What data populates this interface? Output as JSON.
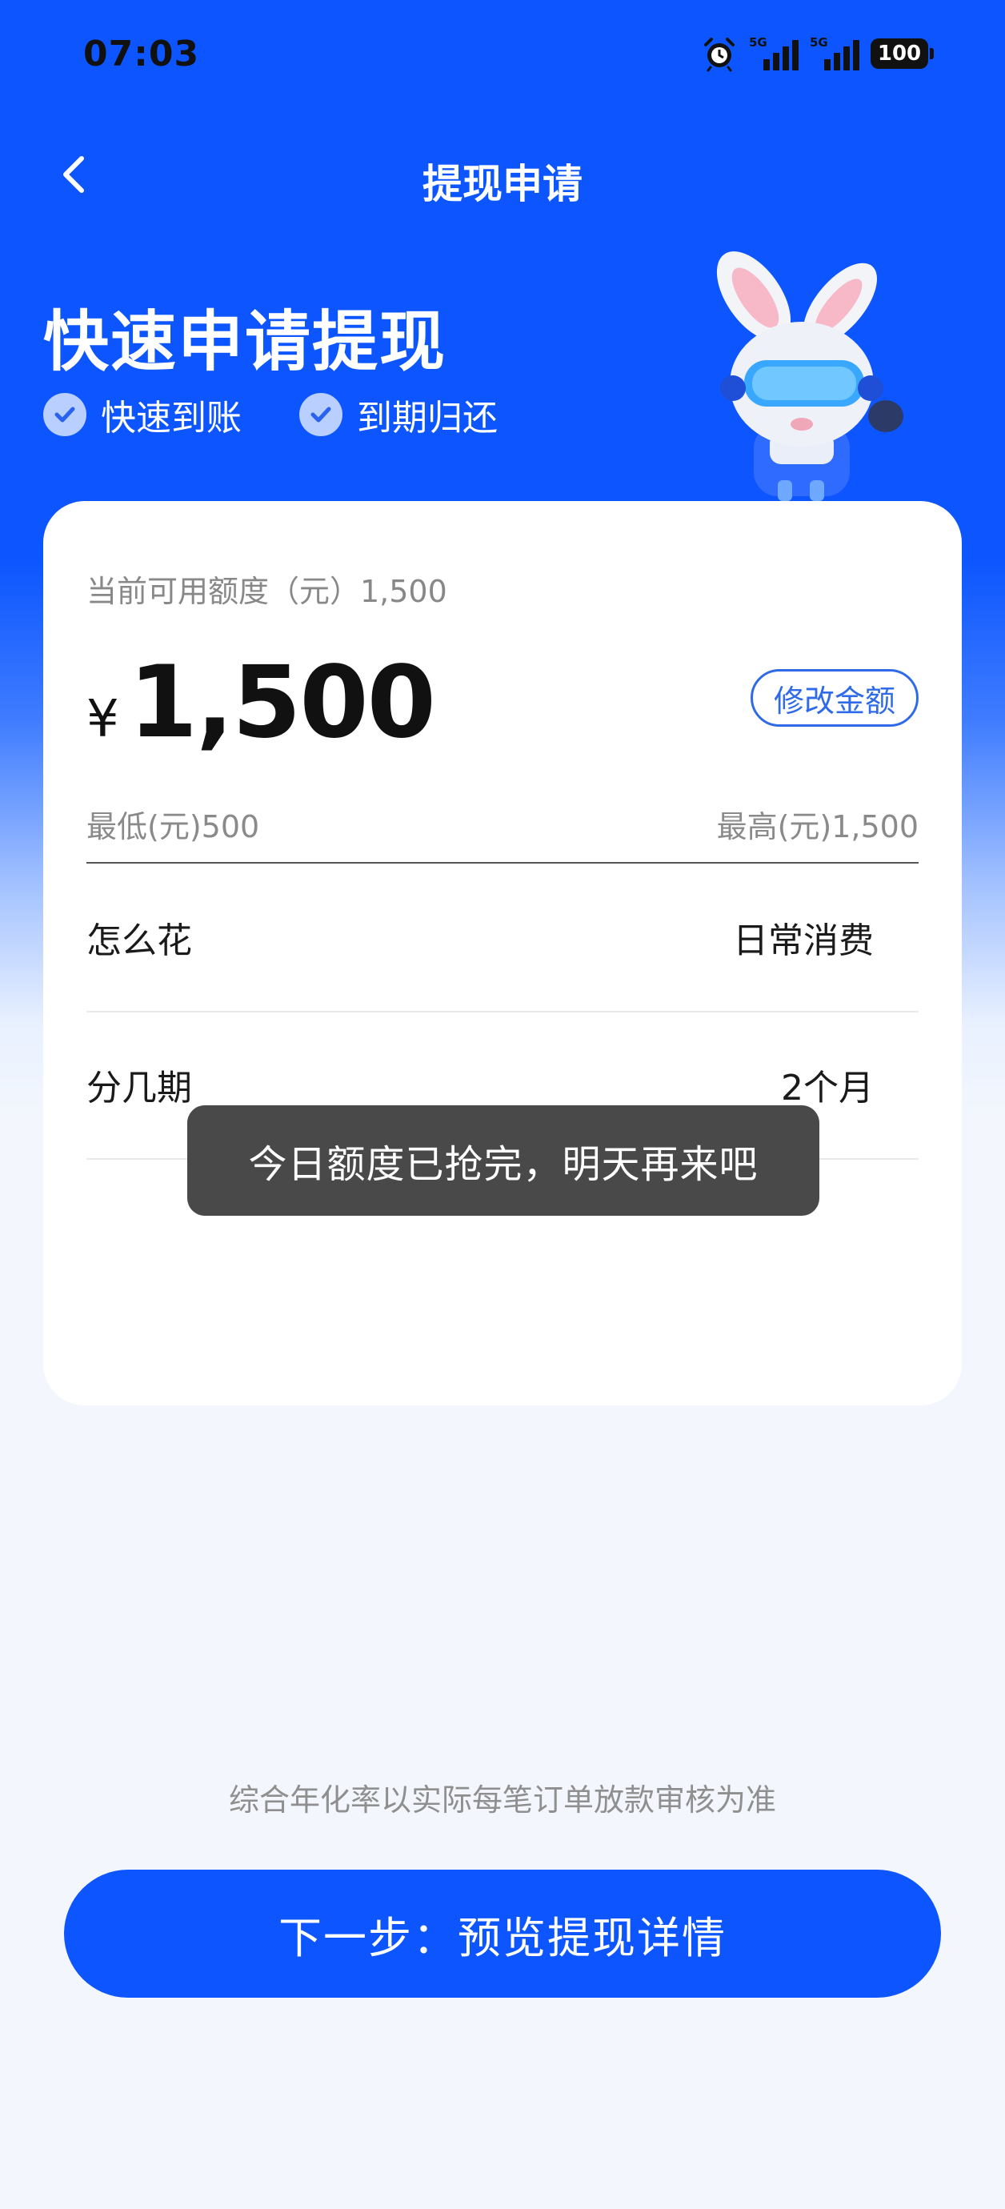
{
  "status_bar": {
    "time": "07:03",
    "net1_label": "5G",
    "net2_label": "5G",
    "battery": "100",
    "icons": [
      "alarm-icon",
      "signal-icon",
      "signal-icon",
      "battery-icon"
    ]
  },
  "nav": {
    "title": "提现申请",
    "back_icon": "chevron-left-icon"
  },
  "hero": {
    "title": "快速申请提现",
    "features": [
      "快速到账",
      "到期归还"
    ],
    "feature_icon": "check-circle-icon"
  },
  "form": {
    "available_label": "当前可用额度（元）1,500",
    "currency_symbol": "¥",
    "amount": "1,500",
    "modify_button": "修改金额",
    "min_label": "最低(元)500",
    "max_label": "最高(元)1,500",
    "purpose_label": "怎么花",
    "purpose_value": "日常消费",
    "term_label": "分几期",
    "term_value": "2个月"
  },
  "toast": {
    "message": "今日额度已抢完，明天再来吧"
  },
  "footer": {
    "apr_note": "综合年化率以实际每笔订单放款审核为准",
    "next_button": "下一步：预览提现详情"
  },
  "colors": {
    "brand_blue": "#0d56ff",
    "outline_blue": "#2f6be8",
    "toast_bg": "#3a3a3a"
  }
}
